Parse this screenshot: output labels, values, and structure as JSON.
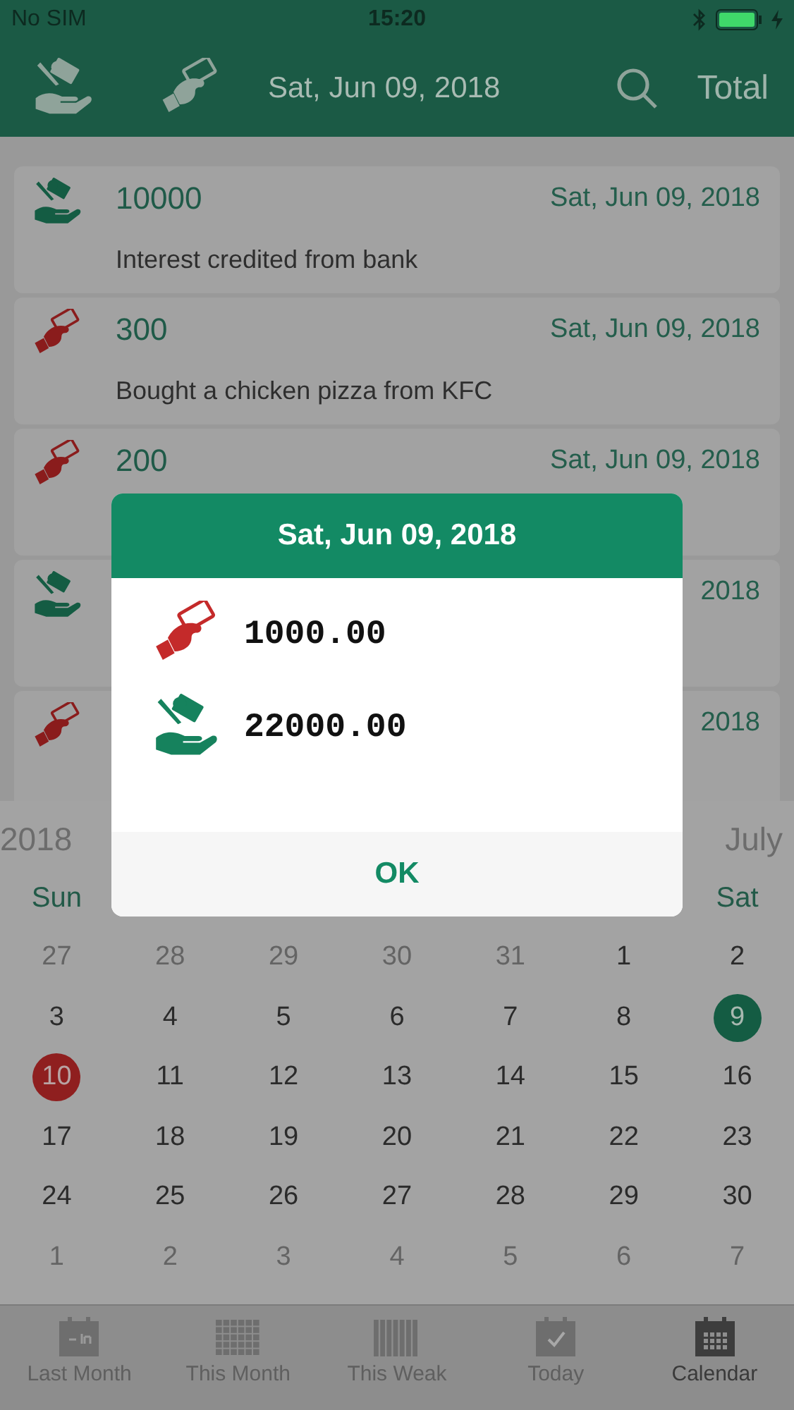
{
  "status_bar": {
    "carrier": "No SIM",
    "time": "15:20"
  },
  "nav_bar": {
    "title": "Sat, Jun 09, 2018",
    "total_button": "Total"
  },
  "transactions": [
    {
      "kind": "income",
      "amount": "10000",
      "date": "Sat, Jun 09, 2018",
      "note": "Interest credited from bank"
    },
    {
      "kind": "expense",
      "amount": "300",
      "date": "Sat, Jun 09, 2018",
      "note": "Bought a chicken pizza from KFC"
    },
    {
      "kind": "expense",
      "amount": "200",
      "date": "Sat, Jun 09, 2018"
    },
    {
      "kind": "income",
      "date": "2018"
    },
    {
      "kind": "expense",
      "date": "2018"
    }
  ],
  "calendar": {
    "prev_label": "2018",
    "next_label": "July",
    "weekdays": [
      "Sun",
      "Sat"
    ],
    "weeks": [
      [
        {
          "day": "27",
          "kind": "other"
        },
        {
          "day": "28",
          "kind": "other"
        },
        {
          "day": "29",
          "kind": "other"
        },
        {
          "day": "30",
          "kind": "other"
        },
        {
          "day": "31",
          "kind": "other"
        },
        {
          "day": "1",
          "kind": "normal"
        },
        {
          "day": "2",
          "kind": "normal"
        }
      ],
      [
        {
          "day": "3",
          "kind": "normal"
        },
        {
          "day": "4",
          "kind": "normal"
        },
        {
          "day": "5",
          "kind": "normal"
        },
        {
          "day": "6",
          "kind": "normal"
        },
        {
          "day": "7",
          "kind": "normal"
        },
        {
          "day": "8",
          "kind": "normal"
        },
        {
          "day": "9",
          "kind": "selected"
        }
      ],
      [
        {
          "day": "10",
          "kind": "today"
        },
        {
          "day": "11",
          "kind": "normal"
        },
        {
          "day": "12",
          "kind": "normal"
        },
        {
          "day": "13",
          "kind": "normal"
        },
        {
          "day": "14",
          "kind": "normal"
        },
        {
          "day": "15",
          "kind": "normal"
        },
        {
          "day": "16",
          "kind": "normal"
        }
      ],
      [
        {
          "day": "17",
          "kind": "normal"
        },
        {
          "day": "18",
          "kind": "normal"
        },
        {
          "day": "19",
          "kind": "normal"
        },
        {
          "day": "20",
          "kind": "normal"
        },
        {
          "day": "21",
          "kind": "normal"
        },
        {
          "day": "22",
          "kind": "normal"
        },
        {
          "day": "23",
          "kind": "normal"
        }
      ],
      [
        {
          "day": "24",
          "kind": "normal"
        },
        {
          "day": "25",
          "kind": "normal"
        },
        {
          "day": "26",
          "kind": "normal"
        },
        {
          "day": "27",
          "kind": "normal"
        },
        {
          "day": "28",
          "kind": "normal"
        },
        {
          "day": "29",
          "kind": "normal"
        },
        {
          "day": "30",
          "kind": "normal"
        }
      ],
      [
        {
          "day": "1",
          "kind": "other"
        },
        {
          "day": "2",
          "kind": "other"
        },
        {
          "day": "3",
          "kind": "other"
        },
        {
          "day": "4",
          "kind": "other"
        },
        {
          "day": "5",
          "kind": "other"
        },
        {
          "day": "6",
          "kind": "other"
        },
        {
          "day": "7",
          "kind": "other"
        }
      ]
    ]
  },
  "tab_bar": [
    {
      "label": "Last Month",
      "selected": false
    },
    {
      "label": "This Month",
      "selected": false
    },
    {
      "label": "This Weak",
      "selected": false
    },
    {
      "label": "Today",
      "selected": false
    },
    {
      "label": "Calendar",
      "selected": true
    }
  ],
  "dialog": {
    "title": "Sat, Jun 09, 2018",
    "rows": [
      {
        "kind": "expense",
        "amount": "1000.00"
      },
      {
        "kind": "income",
        "amount": "22000.00"
      }
    ],
    "button": "OK"
  }
}
